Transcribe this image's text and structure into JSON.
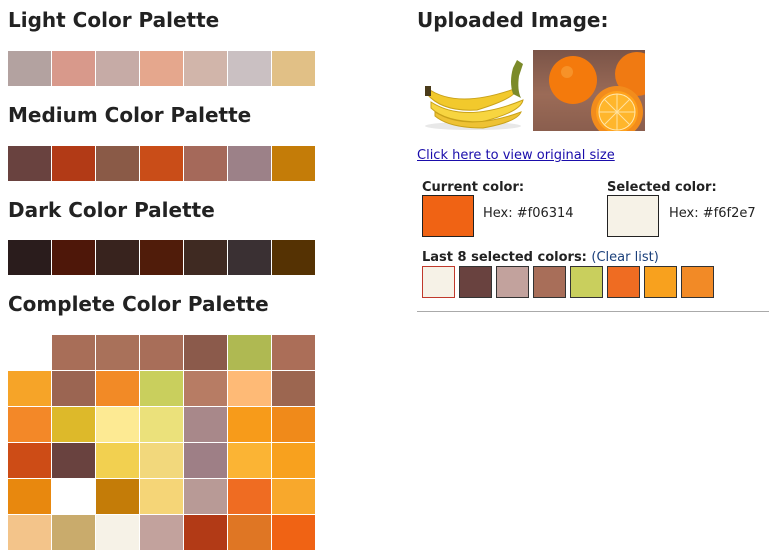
{
  "palettes": {
    "light": {
      "title": "Light Color Palette",
      "colors": [
        "#b3a2a0",
        "#d8998b",
        "#c6aba6",
        "#e5a78d",
        "#d1b5aa",
        "#cac0c2",
        "#e1c086"
      ]
    },
    "medium": {
      "title": "Medium Color Palette",
      "colors": [
        "#69423f",
        "#b23a16",
        "#8a5a47",
        "#c94d18",
        "#a5695a",
        "#9c8188",
        "#c47c08"
      ]
    },
    "dark": {
      "title": "Dark Color Palette",
      "colors": [
        "#2a1c1c",
        "#4e1709",
        "#38231e",
        "#501c0a",
        "#3f2a22",
        "#3a3033",
        "#553203"
      ]
    },
    "complete": {
      "title": "Complete Color Palette",
      "colors": [
        "#ffffff",
        "#a86e58",
        "#a9715a",
        "#a86e59",
        "#8b5a4b",
        "#afb952",
        "#ab6e58",
        "#f6a428",
        "#9b6552",
        "#f28a26",
        "#c9cf5d",
        "#b77c64",
        "#feba76",
        "#9c6650",
        "#f38828",
        "#ddb92a",
        "#fdea93",
        "#ebe17b",
        "#a8888a",
        "#f79b1a",
        "#f08a1a",
        "#cd4c16",
        "#69423f",
        "#f2d050",
        "#f2d87c",
        "#9e7f86",
        "#fbb434",
        "#f8a11e",
        "#e8880e",
        "#ffffff",
        "#c47c08",
        "#f5d577",
        "#b89a96",
        "#ef6c22",
        "#f8a82c",
        "#f3c48a",
        "#c9ab6c",
        "#f6f2e7",
        "#c2a29d",
        "#b23a16",
        "#df7624",
        "#f06314"
      ]
    }
  },
  "right": {
    "heading": "Uploaded Image:",
    "images": [
      "banana-image",
      "orange-image"
    ],
    "view_link": "Click here to view original size",
    "current": {
      "label": "Current color:",
      "hex_label": "Hex: #f06314",
      "color": "#f06314"
    },
    "selected": {
      "label": "Selected color:",
      "hex_label": "Hex: #f6f2e7",
      "color": "#f6f2e7"
    },
    "recent": {
      "label": "Last 8 selected colors:",
      "clear": "(Clear list)",
      "colors": [
        "#f6f2e7",
        "#69423f",
        "#c2a29d",
        "#a86e59",
        "#c9cf5d",
        "#ef6c22",
        "#f8a11e",
        "#f28a26"
      ]
    }
  }
}
